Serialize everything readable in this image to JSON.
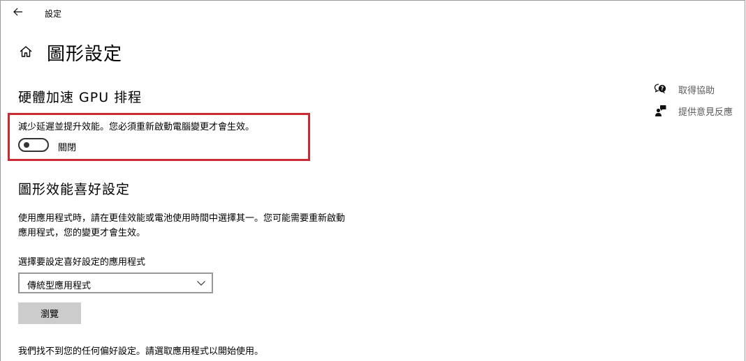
{
  "app": {
    "title": "設定"
  },
  "header": {
    "page_title": "圖形設定"
  },
  "gpu_scheduling": {
    "heading": "硬體加速 GPU 排程",
    "description": "減少延遲並提升效能。您必須重新啟動電腦變更才會生效。",
    "toggle_state": "關閉",
    "toggle_on": false,
    "highlight_color": "#cc2a32"
  },
  "graphics_preference": {
    "heading": "圖形效能喜好設定",
    "description": "使用應用程式時，請在更佳效能或電池使用時間中選擇其一。您可能需要重新啟動應用程式，您的變更才會生效。",
    "select_label": "選擇要設定喜好設定的應用程式",
    "dropdown_value": "傳統型應用程式",
    "browse_label": "瀏覽",
    "empty_message": "我們找不到您的任何偏好設定。請選取應用程式以開始使用。"
  },
  "side_links": {
    "help": "取得協助",
    "feedback": "提供意見反應"
  },
  "icons": {
    "back": "back-arrow-icon",
    "home": "home-icon",
    "help": "help-chat-icon",
    "feedback": "feedback-person-icon",
    "dropdown": "chevron-down-icon"
  }
}
